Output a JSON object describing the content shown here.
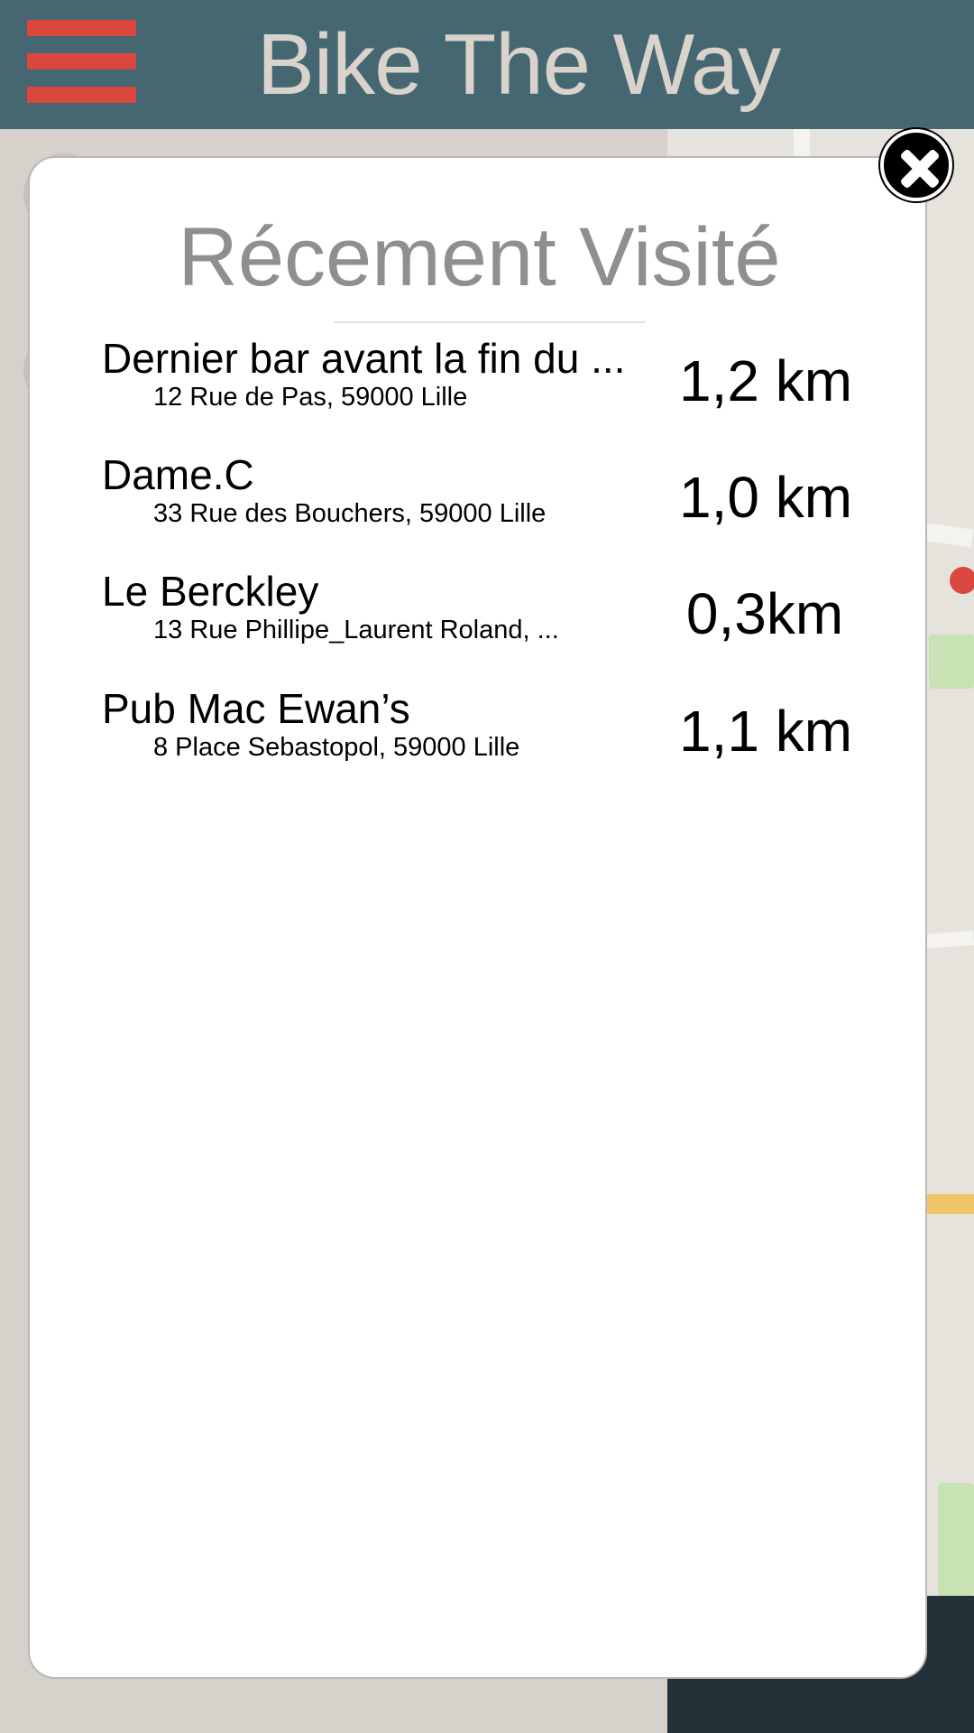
{
  "header": {
    "title": "Bike The Way",
    "menu_icon": "hamburger-menu-icon",
    "accent_color": "#d9473f",
    "bar_color": "#456772"
  },
  "modal": {
    "title": "Récement Visité",
    "close_icon": "close-icon",
    "places": [
      {
        "name": "Dernier bar avant la fin du ...",
        "address": "12 Rue de Pas, 59000 Lille",
        "distance": "1,2 km"
      },
      {
        "name": "Dame.C",
        "address": "33 Rue des Bouchers, 59000 Lille",
        "distance": "1,0 km"
      },
      {
        "name": "Le Berckley",
        "address": "13 Rue Phillipe_Laurent Roland, ...",
        "distance": "0,3km"
      },
      {
        "name": "Pub Mac Ewan’s",
        "address": "8 Place Sebastopol, 59000 Lille",
        "distance": "1,1 km"
      }
    ]
  }
}
